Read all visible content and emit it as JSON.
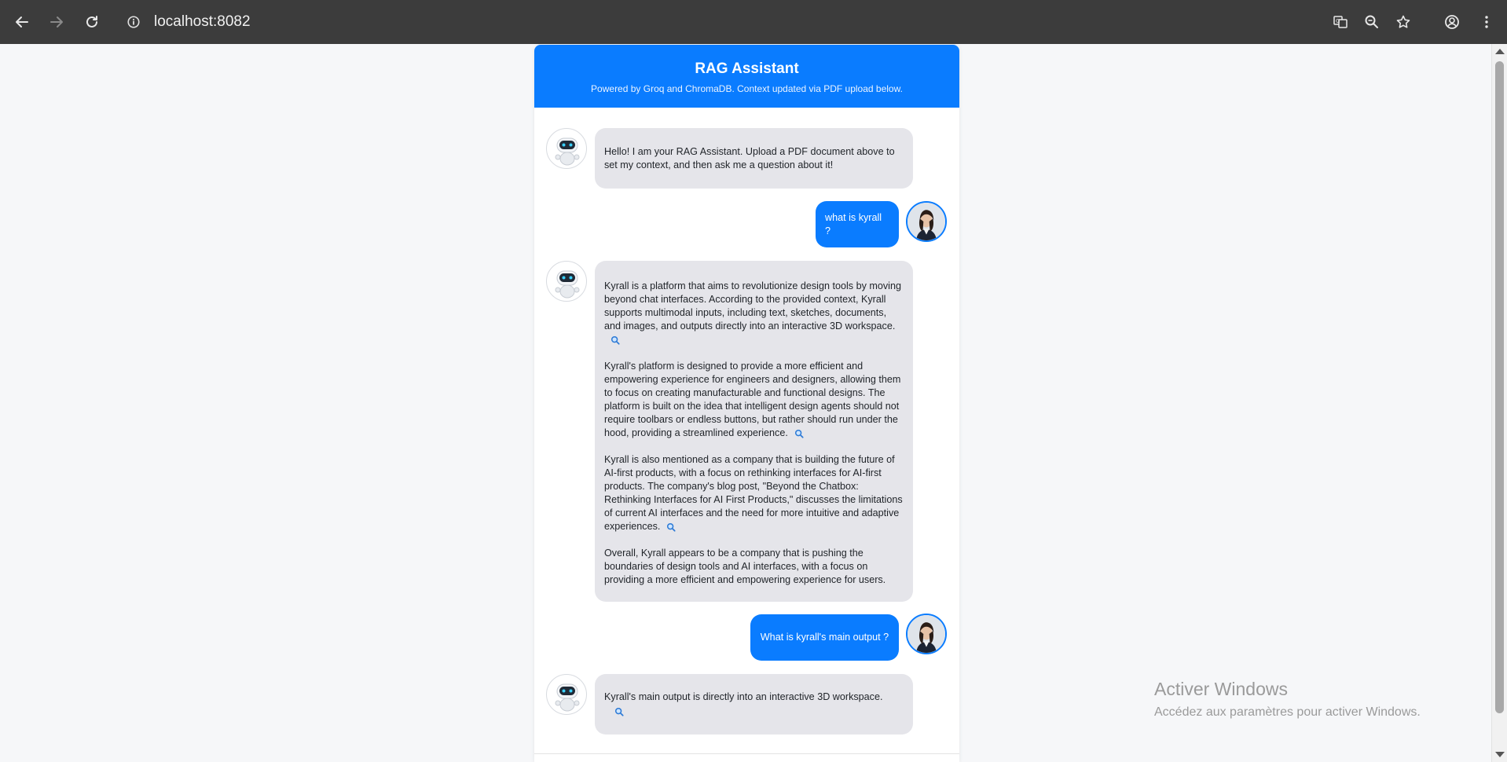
{
  "browser": {
    "url": "localhost:8082",
    "icons": [
      "back-arrow-icon",
      "forward-arrow-icon",
      "reload-icon",
      "site-info-icon",
      "translate-icon",
      "zoom-icon",
      "bookmark-star-icon",
      "profile-icon",
      "menu-kebab-icon"
    ]
  },
  "header": {
    "title": "RAG Assistant",
    "subtitle": "Powered by Groq and ChromaDB. Context updated via PDF upload below."
  },
  "messages": [
    {
      "role": "bot",
      "paragraphs": [
        "Hello! I am your RAG Assistant. Upload a PDF document above to set my context, and then ask me a question about it!"
      ]
    },
    {
      "role": "user",
      "text": "what is kyrall ?"
    },
    {
      "role": "bot",
      "paragraphs": [
        "Kyrall is a platform that aims to revolutionize design tools by moving beyond chat interfaces. According to the provided context, Kyrall supports multimodal inputs, including text, sketches, documents, and images, and outputs directly into an interactive 3D workspace.",
        "Kyrall's platform is designed to provide a more efficient and empowering experience for engineers and designers, allowing them to focus on creating manufacturable and functional designs. The platform is built on the idea that intelligent design agents should not require toolbars or endless buttons, but rather should run under the hood, providing a streamlined experience.",
        "Kyrall is also mentioned as a company that is building the future of AI-first products, with a focus on rethinking interfaces for AI-first products. The company's blog post, \"Beyond the Chatbox: Rethinking Interfaces for AI First Products,\" discusses the limitations of current AI interfaces and the need for more intuitive and adaptive experiences.",
        "Overall, Kyrall appears to be a company that is pushing the boundaries of design tools and AI interfaces, with a focus on providing a more efficient and empowering experience for users."
      ]
    },
    {
      "role": "user",
      "text": "What is kyrall's main output ?"
    },
    {
      "role": "bot",
      "paragraphs": [
        "Kyrall's main output is directly into an interactive 3D workspace."
      ]
    }
  ],
  "watermark": {
    "title": "Activer Windows",
    "subtitle": "Accédez aux paramètres pour activer Windows."
  },
  "colors": {
    "accent": "#0a7cff",
    "bot_bubble": "#e5e5ea",
    "chrome": "#3c3c3c"
  }
}
